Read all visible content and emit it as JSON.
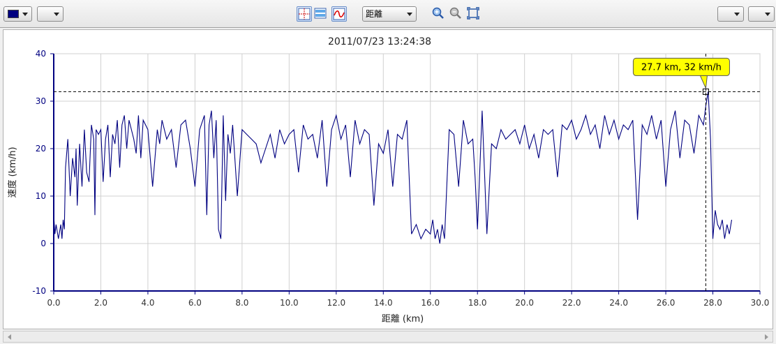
{
  "toolbar": {
    "color_swatch": "#000080",
    "mode_select": "距離",
    "icons": [
      "crosshair-icon",
      "horizontal-bands-icon",
      "smooth-curve-icon",
      "zoom-in-icon",
      "zoom-out-icon",
      "zoom-fit-icon"
    ]
  },
  "chart_data": {
    "type": "line",
    "title": "2011/07/23 13:24:38",
    "xlabel": "距離 (km)",
    "ylabel": "速度 (km/h)",
    "xlim": [
      0,
      30
    ],
    "ylim": [
      -10,
      40
    ],
    "xticks": [
      "0.0",
      "2.0",
      "4.0",
      "6.0",
      "8.0",
      "10.0",
      "12.0",
      "14.0",
      "16.0",
      "18.0",
      "20.0",
      "22.0",
      "24.0",
      "26.0",
      "28.0",
      "30.0"
    ],
    "yticks": [
      "-10",
      "0",
      "10",
      "20",
      "30",
      "40"
    ],
    "grid": true,
    "line_color": "#000080",
    "cursor": {
      "x": 27.7,
      "y": 32,
      "label": "27.7 km, 32 km/h"
    },
    "series": [
      {
        "x": [
          0.0,
          0.05,
          0.1,
          0.2,
          0.3,
          0.35,
          0.4,
          0.45,
          0.5,
          0.6,
          0.7,
          0.8,
          0.9,
          0.95,
          1.0,
          1.1,
          1.2,
          1.3,
          1.4,
          1.5,
          1.6,
          1.7,
          1.75,
          1.8,
          1.9,
          2.0,
          2.1,
          2.2,
          2.3,
          2.4,
          2.5,
          2.6,
          2.7,
          2.8,
          2.9,
          3.0,
          3.1,
          3.2,
          3.3,
          3.4,
          3.5,
          3.6,
          3.7,
          3.8,
          3.9,
          4.0,
          4.2,
          4.4,
          4.5,
          4.6,
          4.8,
          5.0,
          5.2,
          5.4,
          5.6,
          5.8,
          6.0,
          6.2,
          6.4,
          6.5,
          6.6,
          6.7,
          6.8,
          6.9,
          7.0,
          7.1,
          7.2,
          7.3,
          7.4,
          7.5,
          7.6,
          7.8,
          8.0,
          8.2,
          8.4,
          8.6,
          8.8,
          9.0,
          9.2,
          9.4,
          9.6,
          9.8,
          10.0,
          10.2,
          10.4,
          10.6,
          10.8,
          11.0,
          11.2,
          11.4,
          11.6,
          11.8,
          12.0,
          12.2,
          12.4,
          12.6,
          12.8,
          13.0,
          13.2,
          13.4,
          13.6,
          13.8,
          14.0,
          14.2,
          14.4,
          14.6,
          14.8,
          15.0,
          15.2,
          15.4,
          15.6,
          15.8,
          16.0,
          16.1,
          16.2,
          16.3,
          16.4,
          16.5,
          16.6,
          16.8,
          17.0,
          17.2,
          17.4,
          17.6,
          17.8,
          17.9,
          18.0,
          18.2,
          18.4,
          18.6,
          18.8,
          19.0,
          19.2,
          19.4,
          19.6,
          19.8,
          20.0,
          20.2,
          20.4,
          20.6,
          20.8,
          21.0,
          21.2,
          21.4,
          21.6,
          21.8,
          22.0,
          22.2,
          22.4,
          22.6,
          22.8,
          23.0,
          23.2,
          23.4,
          23.6,
          23.8,
          24.0,
          24.2,
          24.4,
          24.6,
          24.8,
          25.0,
          25.2,
          25.4,
          25.6,
          25.8,
          26.0,
          26.2,
          26.4,
          26.6,
          26.8,
          27.0,
          27.2,
          27.4,
          27.6,
          27.7,
          27.8,
          27.85,
          27.9,
          28.0,
          28.1,
          28.2,
          28.3,
          28.4,
          28.5,
          28.6,
          28.7,
          28.8
        ],
        "y": [
          6,
          2,
          4,
          1,
          4,
          1,
          5,
          3,
          16,
          22,
          10,
          18,
          14,
          20,
          8,
          21,
          12,
          24,
          15,
          13,
          25,
          22,
          6,
          24,
          23,
          24,
          13,
          22,
          25,
          14,
          23,
          21,
          26,
          16,
          25,
          27,
          20,
          26,
          24,
          22,
          19,
          27,
          18,
          26,
          25,
          24,
          12,
          24,
          21,
          26,
          22,
          24,
          16,
          25,
          26,
          20,
          12,
          24,
          27,
          6,
          25,
          28,
          18,
          26,
          3,
          1,
          27,
          9,
          23,
          19,
          25,
          10,
          24,
          23,
          22,
          21,
          17,
          20,
          23,
          18,
          24,
          21,
          23,
          24,
          15,
          25,
          22,
          23,
          18,
          26,
          12,
          24,
          27,
          22,
          25,
          14,
          26,
          21,
          24,
          23,
          8,
          21,
          19,
          24,
          12,
          23,
          22,
          26,
          2,
          4,
          1,
          3,
          2,
          5,
          1,
          3,
          0,
          4,
          1,
          24,
          23,
          12,
          26,
          21,
          22,
          14,
          3,
          28,
          2,
          21,
          20,
          24,
          22,
          23,
          24,
          21,
          25,
          20,
          23,
          18,
          24,
          23,
          24,
          14,
          25,
          24,
          26,
          22,
          24,
          27,
          23,
          25,
          20,
          27,
          23,
          26,
          22,
          25,
          24,
          26,
          5,
          25,
          23,
          27,
          22,
          26,
          12,
          24,
          28,
          18,
          26,
          25,
          19,
          27,
          25,
          29,
          32,
          27,
          22,
          1,
          7,
          4,
          3,
          5,
          1,
          4,
          2,
          5
        ],
        "name": ""
      }
    ]
  }
}
